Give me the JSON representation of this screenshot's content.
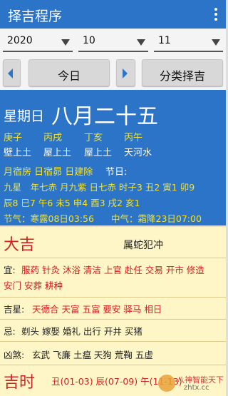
{
  "appbar": {
    "title": "择吉程序"
  },
  "selects": {
    "year": "2020",
    "month": "10",
    "day": "11"
  },
  "nav": {
    "today": "今日",
    "category": "分类择吉"
  },
  "info": {
    "weekday": "星期日",
    "lunar_date": "八月二十五",
    "ganzhi": [
      "庚子",
      "丙戌",
      "丁亥",
      "丙午"
    ],
    "nayin": [
      "壁上土",
      "屋上土",
      "屋上土",
      "天河水"
    ],
    "sukuyo_line": "月宿房 日宿昴 日建除",
    "festival_label": "节日:",
    "star_line1": "九星　年七赤 月九紫 日七赤 时子3 丑2 寅1 卯9",
    "star_line2": "辰8 巳7 午6 未5 申4 酉3 戌2 亥1",
    "solar_term": "节气：寒露08日03:56",
    "mid_term": "中气：霜降23日07:00"
  },
  "panel": {
    "lucky_heading": "大吉",
    "conflict": "属蛇犯冲",
    "yi_label": "宜:",
    "yi_line1": "服药 针灸 沐浴 清洁 上官 赴任 交易 开市 修造",
    "yi_line2": "安门 安葬 耕种",
    "jishen_label": "吉星:",
    "jishen_value": "天德合 天富 五富 要安 驿马 相日",
    "ji_label": "忌:",
    "ji_value": "剃头 嫁娶 婚礼 出行 开井 买猪",
    "xiongsha_label": "凶煞:",
    "xiongsha_value": "玄武 飞廉 土瘟 天狗 荒鞠 五虚",
    "jishi_heading": "吉时",
    "jishi_value": "丑(01-03) 辰(07-09) 午(11-13)"
  },
  "watermark": {
    "line1": "八神智能天下",
    "line2": "zhtx.cc"
  },
  "colors": {
    "primary": "#2b74c8",
    "highlight": "#f5e22e",
    "lucky_red": "#d22020",
    "panel_bg": "#fff6c8"
  }
}
